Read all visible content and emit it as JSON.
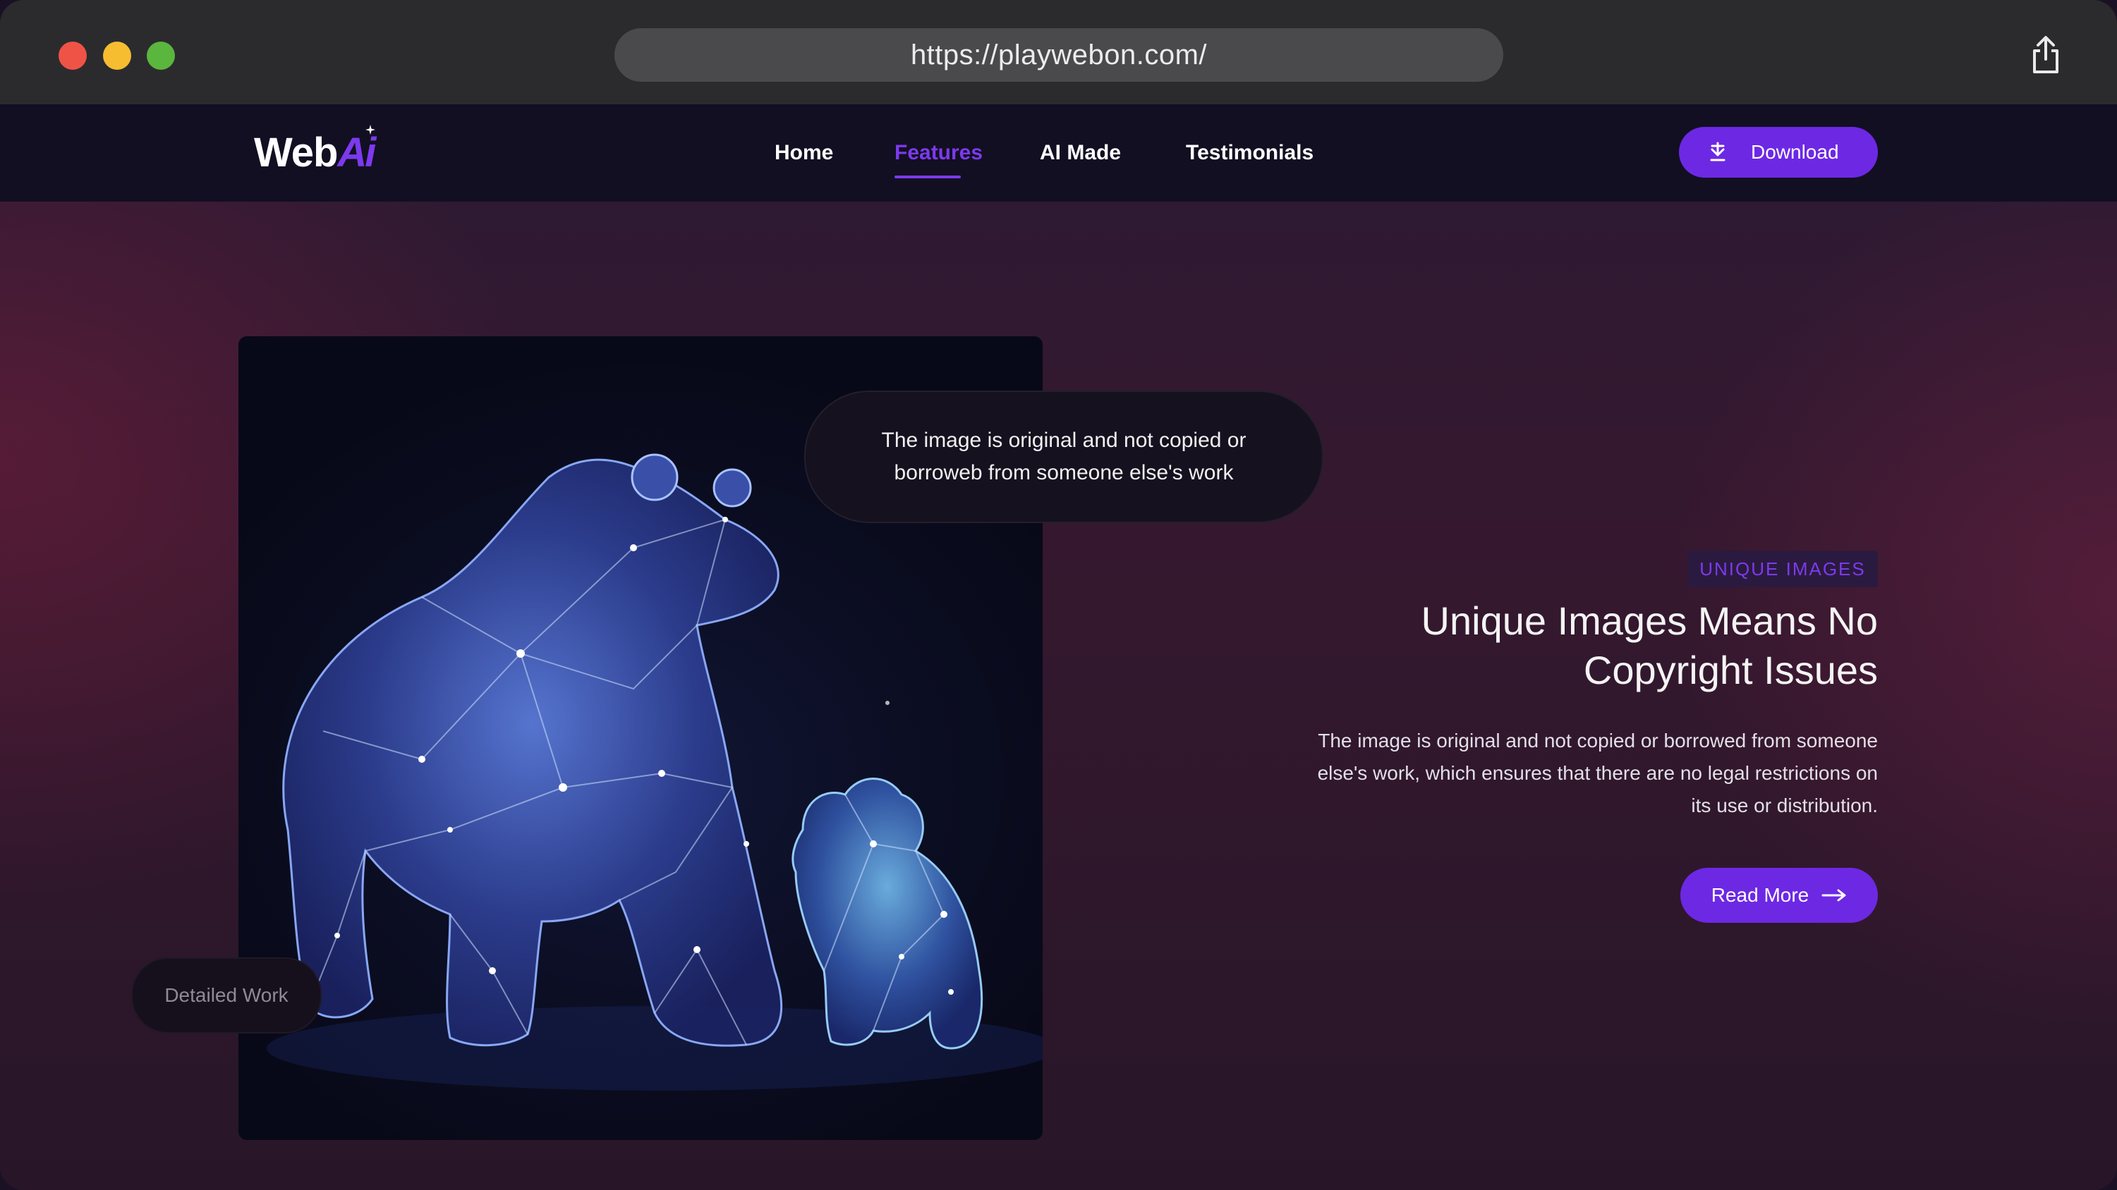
{
  "browser": {
    "url": "https://playwebon.com/",
    "icons": {
      "close": "traffic-light-red",
      "minimize": "traffic-light-yellow",
      "zoom": "traffic-light-green",
      "share": "share-icon"
    }
  },
  "brand": {
    "logo_web": "Web",
    "logo_ai": "Ai"
  },
  "nav": {
    "items": [
      {
        "label": "Home"
      },
      {
        "label": "Features",
        "active": true
      },
      {
        "label": "AI Made"
      },
      {
        "label": "Testimonials"
      }
    ],
    "download_label": "Download",
    "download_icon": "download-icon"
  },
  "hero": {
    "image_subject": "polar-bears-constellation-image",
    "quote": "The image is original and not copied or borroweb from someone else's work",
    "detail_label": "Detailed Work",
    "badge": "UNIQUE IMAGES",
    "headline": "Unique Images Means No Copyright Issues",
    "body": "The image is original and not copied or borrowed from someone else's work, which ensures that there are no legal restrictions on its use or distribution.",
    "cta_label": "Read More",
    "cta_icon": "arrow-right-icon"
  },
  "colors": {
    "accent": "#7c3aed",
    "button": "#6d28e4",
    "nav_bg": "#120f22",
    "chrome_bg": "#2b2b2e"
  }
}
